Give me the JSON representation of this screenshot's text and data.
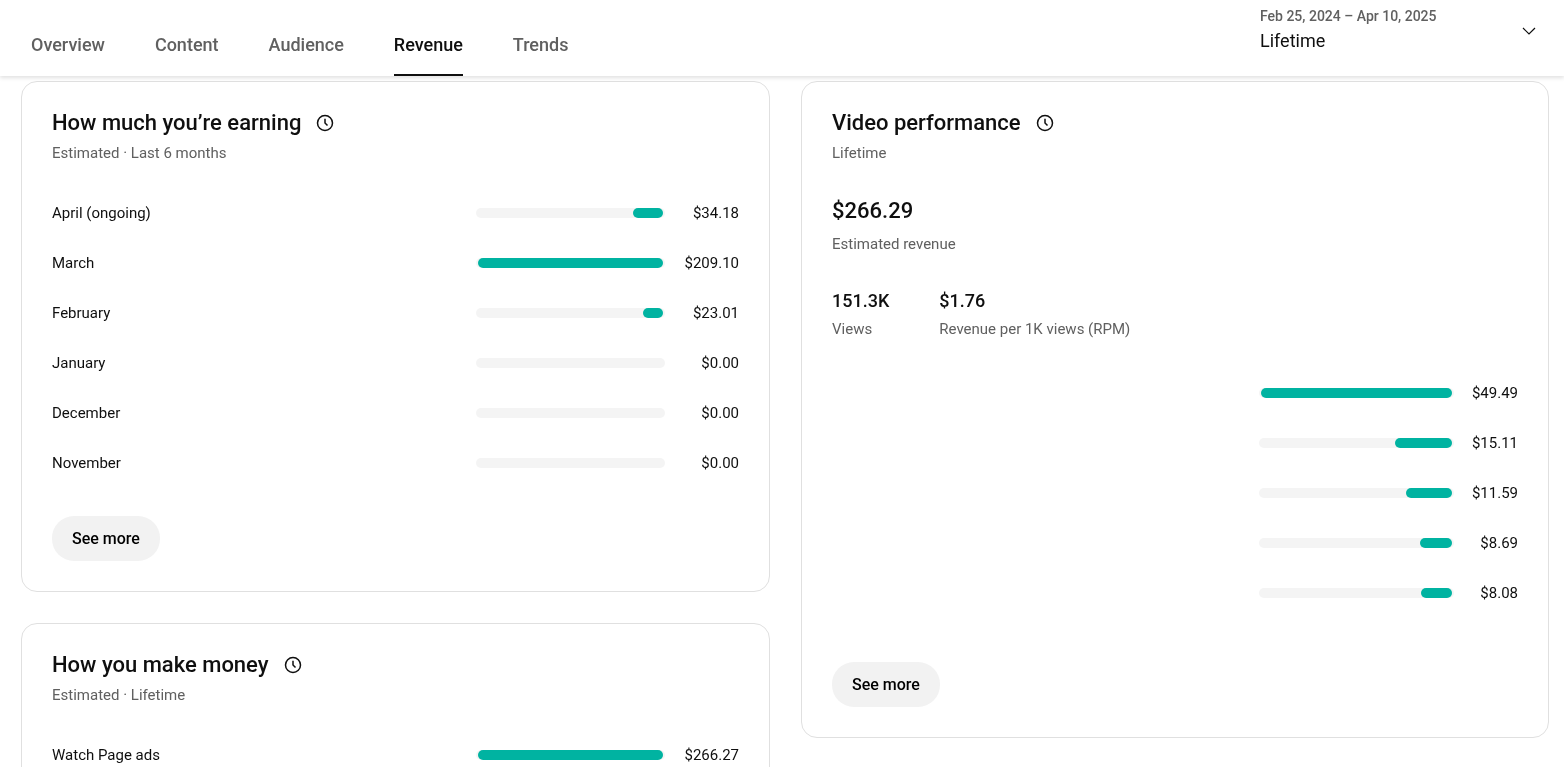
{
  "tabs": [
    {
      "label": "Overview",
      "selected": false
    },
    {
      "label": "Content",
      "selected": false
    },
    {
      "label": "Audience",
      "selected": false
    },
    {
      "label": "Revenue",
      "selected": true
    },
    {
      "label": "Trends",
      "selected": false
    }
  ],
  "date_range": {
    "range": "Feb 25, 2024 – Apr 10, 2025",
    "period": "Lifetime"
  },
  "earning": {
    "title": "How much you’re earning",
    "subtitle": "Estimated · Last 6 months",
    "rows": [
      {
        "label": "April (ongoing)",
        "level": 0.16,
        "value": "$34.18"
      },
      {
        "label": "March",
        "level": 1,
        "value": "$209.10"
      },
      {
        "label": "February",
        "level": 0.11,
        "value": "$23.01"
      },
      {
        "label": "January",
        "level": 0,
        "value": "$0.00"
      },
      {
        "label": "December",
        "level": 0,
        "value": "$0.00"
      },
      {
        "label": "November",
        "level": 0,
        "value": "$0.00"
      }
    ],
    "button": "See more"
  },
  "money": {
    "title": "How you make money",
    "subtitle": "Estimated · Lifetime",
    "rows": [
      {
        "label": "Watch Page ads",
        "level": 1,
        "value": "$266.27"
      }
    ]
  },
  "video": {
    "title": "Video performance",
    "subtitle": "Lifetime",
    "total": "$266.29",
    "total_label": "Estimated revenue",
    "stats": [
      {
        "value": "151.3K",
        "label": "Views"
      },
      {
        "value": "$1.76",
        "label": "Revenue per 1K views (RPM)"
      }
    ],
    "rows": [
      {
        "level": 1,
        "value": "$49.49"
      },
      {
        "level": 0.3,
        "value": "$15.11"
      },
      {
        "level": 0.24,
        "value": "$11.59"
      },
      {
        "level": 0.17,
        "value": "$8.69"
      },
      {
        "level": 0.16,
        "value": "$8.08"
      }
    ],
    "button": "See more"
  }
}
